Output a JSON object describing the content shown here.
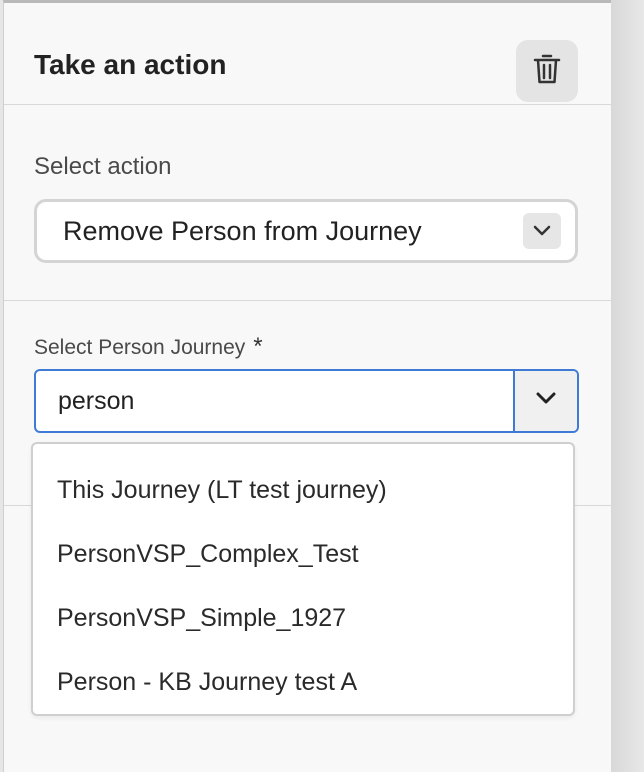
{
  "panel": {
    "title": "Take an action",
    "delete_icon": "trash-icon"
  },
  "action": {
    "label": "Select action",
    "selected_value": "Remove Person from Journey",
    "chevron_icon": "chevron-down-icon"
  },
  "journey": {
    "label": "Select Person Journey",
    "required_marker": "*",
    "input_value": "person",
    "chevron_icon": "chevron-down-icon",
    "options": [
      "This Journey (LT test journey)",
      "PersonVSP_Complex_Test",
      "PersonVSP_Simple_1927",
      "Person - KB Journey test A"
    ]
  },
  "colors": {
    "focus_blue": "#3f7ad7",
    "panel_background": "#f8f8f8"
  }
}
